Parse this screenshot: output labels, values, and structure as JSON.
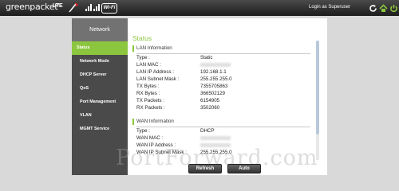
{
  "header": {
    "logo": "greenpacket",
    "logo_mark": "e",
    "lte_label": "LTE",
    "wifi_label": "Wi-Fi",
    "login_text": "Login as Superuser"
  },
  "sidebar": {
    "title": "Network",
    "items": [
      {
        "label": "Status",
        "active": true
      },
      {
        "label": "Network Mode"
      },
      {
        "label": "DHCP Server"
      },
      {
        "label": "QoS"
      },
      {
        "label": "Port Management"
      },
      {
        "label": "VLAN"
      },
      {
        "label": "MGMT Service"
      }
    ]
  },
  "main": {
    "title": "Status",
    "lan": {
      "heading": "LAN Information",
      "rows": [
        {
          "key": "Type :",
          "value": "Static"
        },
        {
          "key": "LAN MAC :",
          "value": ""
        },
        {
          "key": "LAN IP Address :",
          "value": "192.168.1.1"
        },
        {
          "key": "LAN Subnet Mask :",
          "value": "255.255.255.0"
        },
        {
          "key": "TX Bytes :",
          "value": "7355705863"
        },
        {
          "key": "RX Bytes :",
          "value": "366502129"
        },
        {
          "key": "TX Packets :",
          "value": "6154905"
        },
        {
          "key": "RX Packets :",
          "value": "3502060"
        }
      ]
    },
    "wan": {
      "heading": "WAN Information",
      "rows": [
        {
          "key": "Type :",
          "value": "DHCP"
        },
        {
          "key": "WAN MAC :",
          "value": ""
        },
        {
          "key": "WAN IP Address :",
          "value": ""
        },
        {
          "key": "WAN IP Subnet Mask :",
          "value": "255.255.255.0"
        }
      ]
    }
  },
  "buttons": {
    "refresh": "Refresh",
    "auto": "Auto"
  },
  "watermark": "PortForward.com",
  "colors": {
    "accent": "#8cc63f",
    "sidebar_bg": "#4a4a4a",
    "topbar_bg": "#2a2a2a"
  },
  "icons": [
    "phone-icon",
    "wifi-icon",
    "home-icon",
    "refresh-icon",
    "power-icon"
  ]
}
